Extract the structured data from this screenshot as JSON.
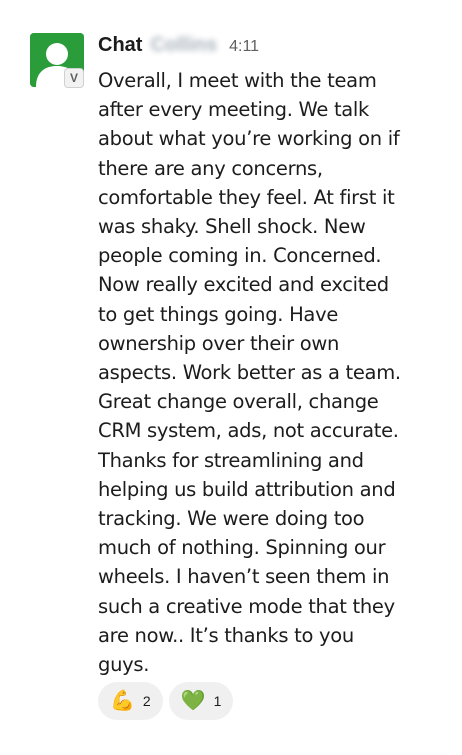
{
  "message": {
    "sender_first": "Chat",
    "sender_last": "Collins",
    "timestamp": "4:11",
    "avatar_badge": "V",
    "lines": [
      "Overall, I meet with the team",
      "after every meeting. We talk",
      "about what you’re working on if",
      "there are any concerns,",
      "comfortable they feel. At first it",
      "was shaky. Shell shock. New",
      "people coming in. Concerned.",
      "Now really excited and excited",
      "to get things going. Have",
      "ownership over their own",
      "aspects. Work better as a team.",
      "Great change overall, change",
      "CRM system, ads, not accurate.",
      "Thanks for streamlining and",
      "helping us build attribution and",
      "tracking. We were doing too",
      "much of nothing. Spinning our",
      "wheels. I haven’t seen them in",
      "such a creative mode that they",
      "are now.. It’s thanks to you",
      "guys."
    ]
  },
  "reactions": [
    {
      "emoji": "💪",
      "icon": "flexed-biceps-icon",
      "count": "2"
    },
    {
      "emoji": "💚",
      "icon": "green-heart-icon",
      "count": "1"
    }
  ],
  "colors": {
    "avatar_bg": "#2a9d3a",
    "text": "#1d1c1d",
    "muted": "#616061",
    "reaction_bg": "#f0f0f0"
  }
}
